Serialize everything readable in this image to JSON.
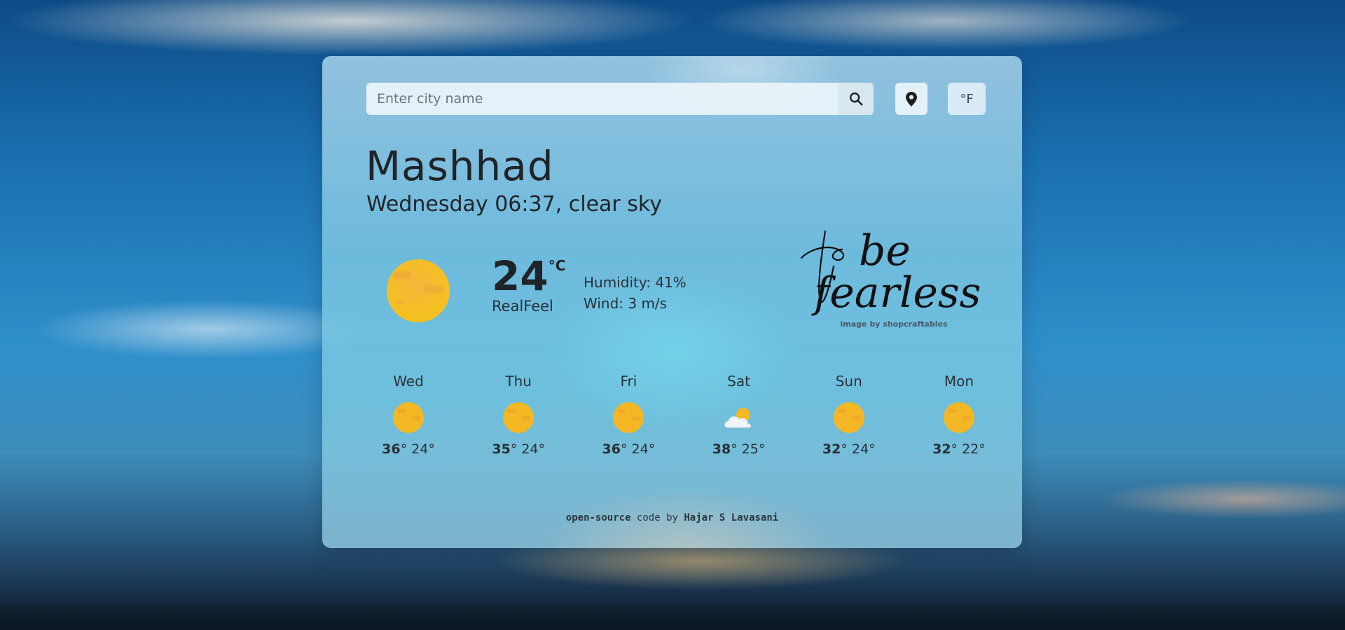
{
  "search": {
    "placeholder": "Enter city name",
    "search_icon": "search-icon",
    "location_icon": "map-pin-icon",
    "unit_toggle_label": "°F"
  },
  "current": {
    "city": "Mashhad",
    "datetime": "Wednesday 06:37, clear sky",
    "icon": "sun-icon",
    "temperature": "24",
    "unit": "°C",
    "realfeel_label": "RealFeel",
    "humidity": "Humidity: 41%",
    "wind": "Wind: 3 m/s"
  },
  "quote": {
    "line1": "be",
    "line2": "fearless",
    "credit": "image by shopcraftables"
  },
  "forecast": [
    {
      "day": "Wed",
      "icon": "sun-icon",
      "max": "36",
      "min": "24°"
    },
    {
      "day": "Thu",
      "icon": "sun-icon",
      "max": "35",
      "min": "24°"
    },
    {
      "day": "Fri",
      "icon": "sun-icon",
      "max": "36",
      "min": "24°"
    },
    {
      "day": "Sat",
      "icon": "cloud-sun-icon",
      "max": "38",
      "min": "25°"
    },
    {
      "day": "Sun",
      "icon": "sun-icon",
      "max": "32",
      "min": "24°"
    },
    {
      "day": "Mon",
      "icon": "sun-icon",
      "max": "32",
      "min": "22°"
    }
  ],
  "footer": {
    "part1": "open-source",
    "part2": " code by ",
    "author": "Hajar S Lavasani"
  },
  "colors": {
    "sun": "#f5b51f",
    "text": "#1f2428"
  }
}
